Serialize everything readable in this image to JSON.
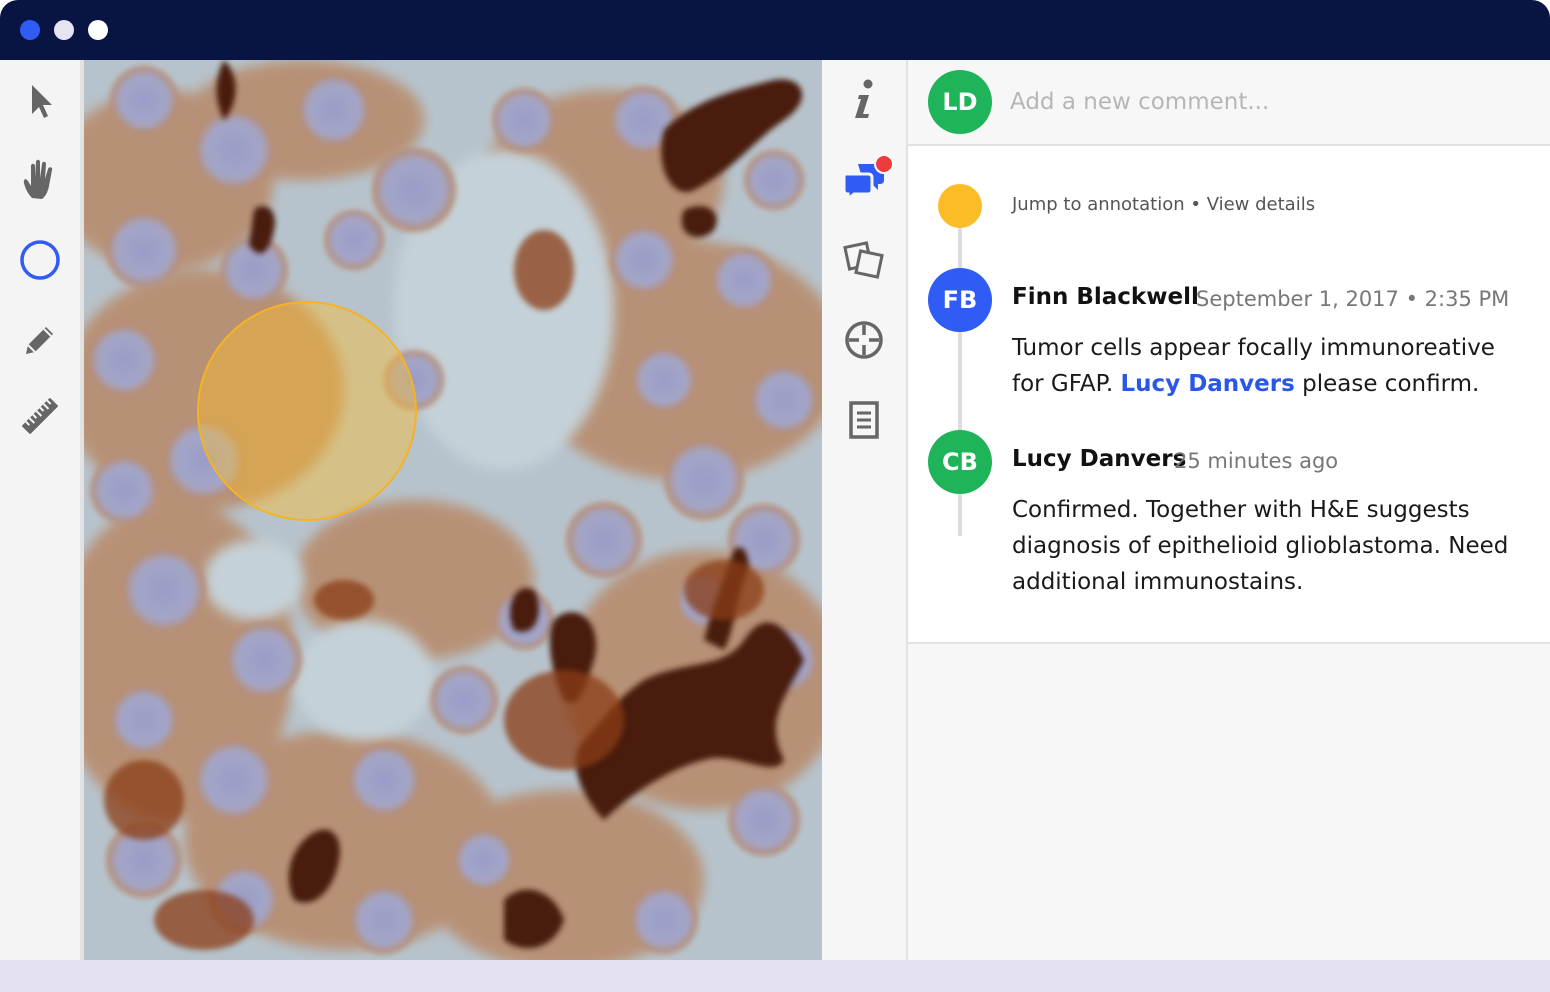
{
  "window": {
    "dots": [
      "close",
      "minimize",
      "maximize"
    ]
  },
  "colors": {
    "titlebar": "#081542",
    "accent_blue": "#2f5cf5",
    "annotation": "#f5b324",
    "avatar_ld": "#1fb35a",
    "avatar_fb": "#2f5cf5",
    "avatar_cb": "#1fb35a",
    "notification": "#ee3b3b"
  },
  "toolbar": {
    "tools": [
      {
        "name": "select",
        "icon": "cursor-arrow-icon"
      },
      {
        "name": "pan",
        "icon": "hand-icon"
      },
      {
        "name": "circle",
        "icon": "circle-icon",
        "active": true
      },
      {
        "name": "draw",
        "icon": "pencil-icon"
      },
      {
        "name": "measure",
        "icon": "ruler-icon"
      }
    ]
  },
  "panel_icons": [
    {
      "name": "info",
      "icon": "info-icon"
    },
    {
      "name": "comments",
      "icon": "chat-bubbles-icon",
      "active": true,
      "notification": true
    },
    {
      "name": "slides",
      "icon": "overlapping-squares-icon"
    },
    {
      "name": "target",
      "icon": "crosshair-icon"
    },
    {
      "name": "report",
      "icon": "document-icon"
    }
  ],
  "composer": {
    "avatar_initials": "LD",
    "placeholder": "Add a new comment..."
  },
  "thread": {
    "jump_link": "Jump to annotation",
    "separator": " • ",
    "details_link": "View details",
    "comments": [
      {
        "initials": "FB",
        "author": "Finn Blackwell",
        "time": "September 1, 2017 • 2:35 PM",
        "body_before": "Tumor cells appear focally immunoreative for GFAP. ",
        "mention": "Lucy Danvers",
        "body_after": " please confirm."
      },
      {
        "initials": "CB",
        "author": "Lucy Danvers",
        "time": "25 minutes ago",
        "body": "Confirmed. Together with H&E suggests diagnosis of epithelioid glioblastoma. Need additional immunostains."
      }
    ]
  }
}
